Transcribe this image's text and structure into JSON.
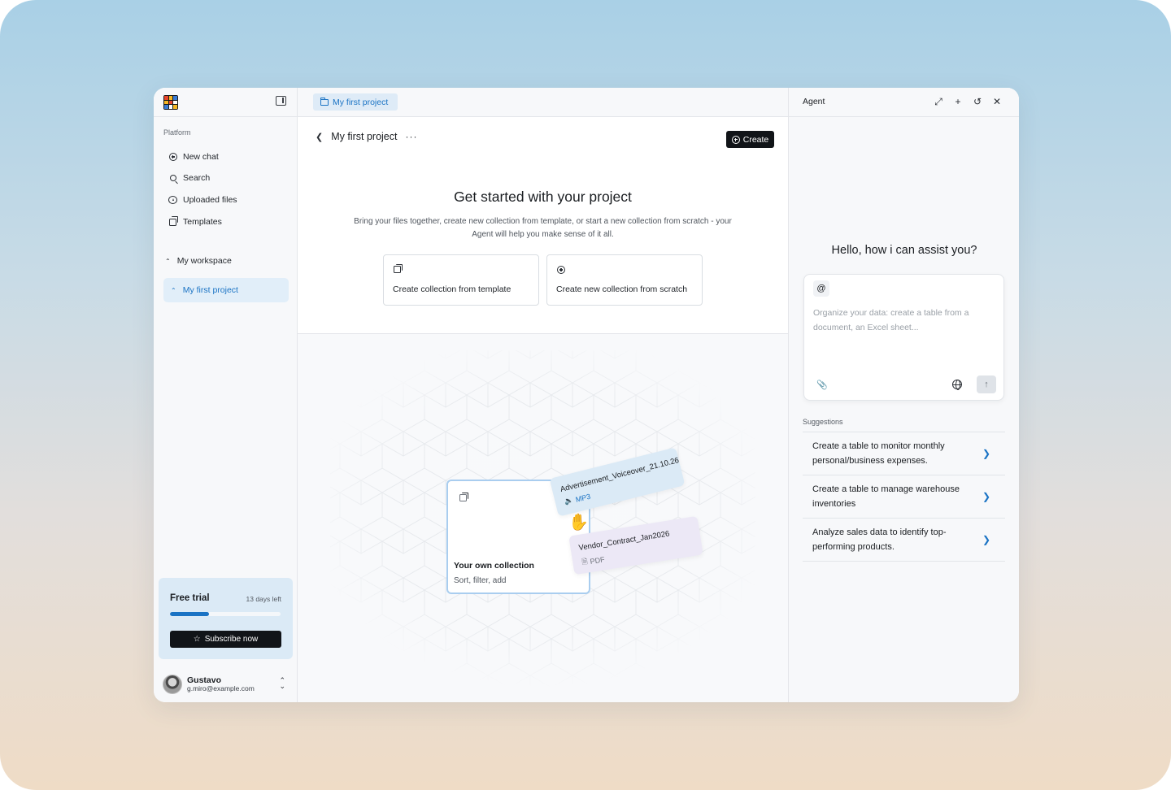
{
  "sidebar": {
    "section_label": "Platform",
    "items": [
      {
        "label": "New chat",
        "icon": "plus-circle-icon"
      },
      {
        "label": "Search",
        "icon": "search-icon"
      },
      {
        "label": "Uploaded files",
        "icon": "cloud-upload-icon"
      },
      {
        "label": "Templates",
        "icon": "copy-icon"
      }
    ],
    "workspace": {
      "label": "My workspace"
    },
    "project": {
      "label": "My first project"
    },
    "trial": {
      "title": "Free trial",
      "days_left": "13 days left",
      "progress": 0.35,
      "button": "Subscribe now"
    },
    "user": {
      "name": "Gustavo",
      "email": "g.miro@example.com"
    }
  },
  "main": {
    "tab_label": "My first project",
    "project_title": "My first project",
    "more": "···",
    "create_label": "Create",
    "hero_title": "Get started with your project",
    "hero_desc": "Bring your files together, create new collection from template, or start a new collection from scratch - your Agent will help you make sense of it all.",
    "options": [
      {
        "label": "Create collection from template",
        "icon": "copy-icon"
      },
      {
        "label": "Create new collection from scratch",
        "icon": "plus-circle-icon"
      }
    ],
    "illustration": {
      "collection_title": "Your own collection",
      "collection_sub": "Sort, filter, add",
      "files": [
        {
          "name": "Advertisement_Voiceover_21.10.26",
          "type": "MP3",
          "icon": "speaker-icon"
        },
        {
          "name": "Vendor_Contract_Jan2026",
          "type": "PDF",
          "icon": "document-icon"
        }
      ]
    }
  },
  "agent": {
    "title": "Agent",
    "greeting": "Hello, how i can assist you?",
    "mention": "@",
    "placeholder": "Organize your data: create a table from a document, an Excel sheet...",
    "suggestions_label": "Suggestions",
    "suggestions": [
      "Create a table to monitor monthly personal/business expenses.",
      "Create a table to manage warehouse inventories",
      "Analyze sales data to identify top-performing products."
    ]
  },
  "colors": {
    "accent": "#1a73c4",
    "dark_button": "#111418",
    "selection_bg": "#e1eef9"
  }
}
